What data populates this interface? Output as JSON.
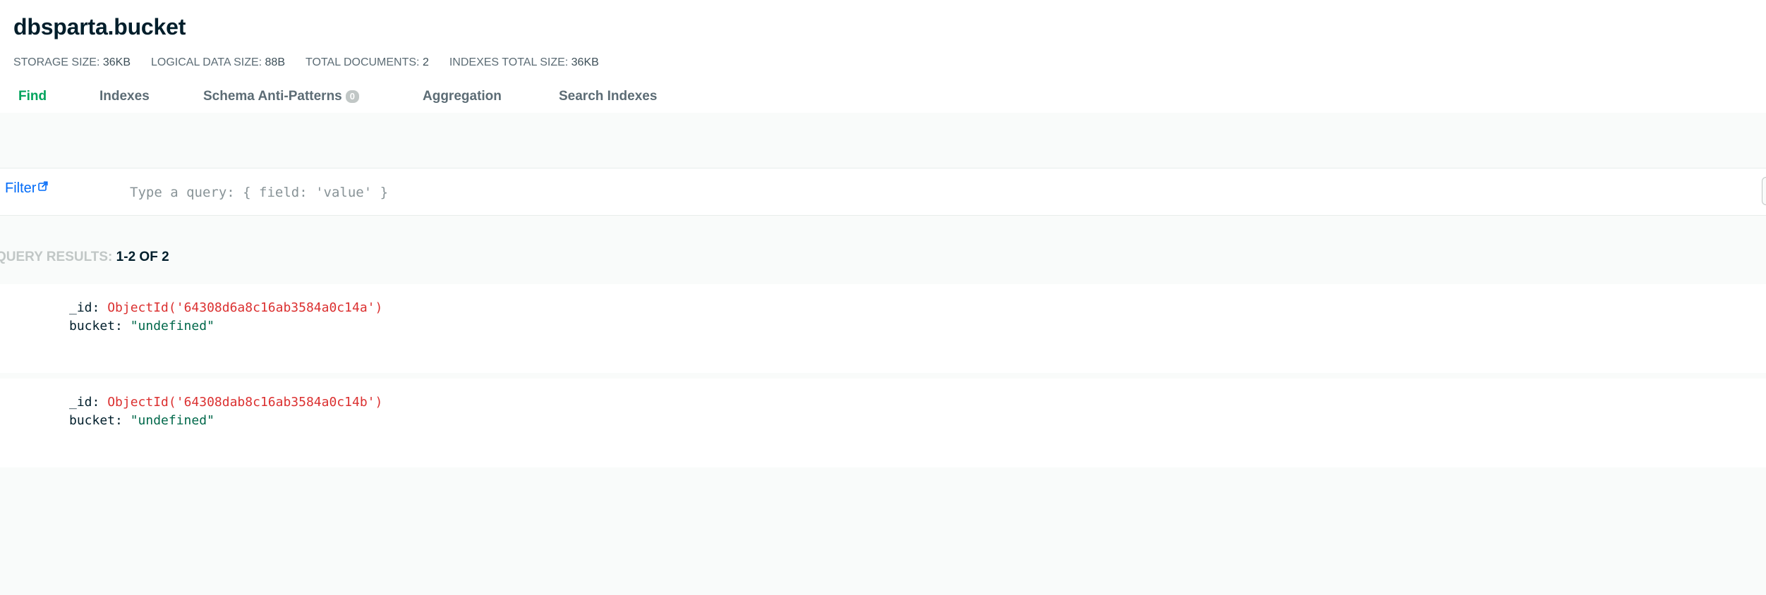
{
  "collection": {
    "title": "dbsparta.bucket"
  },
  "stats": [
    {
      "label": "STORAGE SIZE:",
      "value": "36KB"
    },
    {
      "label": "LOGICAL DATA SIZE:",
      "value": "88B"
    },
    {
      "label": "TOTAL DOCUMENTS:",
      "value": "2"
    },
    {
      "label": "INDEXES TOTAL SIZE:",
      "value": "36KB"
    }
  ],
  "tabs": [
    {
      "label": "Find",
      "active": true
    },
    {
      "label": "Indexes"
    },
    {
      "label": "Schema Anti-Patterns",
      "count": "0"
    },
    {
      "label": "Aggregation"
    },
    {
      "label": "Search Indexes"
    }
  ],
  "filter": {
    "label": "Filter",
    "placeholder": "Type a query: { field: 'value' }",
    "value": ""
  },
  "results": {
    "label": "QUERY RESULTS:",
    "range": "1-2 OF 2"
  },
  "documents": [
    {
      "id_key": "_id:",
      "id_value": "ObjectId('64308d6a8c16ab3584a0c14a')",
      "field_key": "bucket:",
      "field_value": "\"undefined\""
    },
    {
      "id_key": "_id:",
      "id_value": "ObjectId('64308dab8c16ab3584a0c14b')",
      "field_key": "bucket:",
      "field_value": "\"undefined\""
    }
  ],
  "colors": {
    "accent": "#00a35c",
    "link": "#016bf8",
    "objectid": "#db3030",
    "string": "#00684a"
  }
}
